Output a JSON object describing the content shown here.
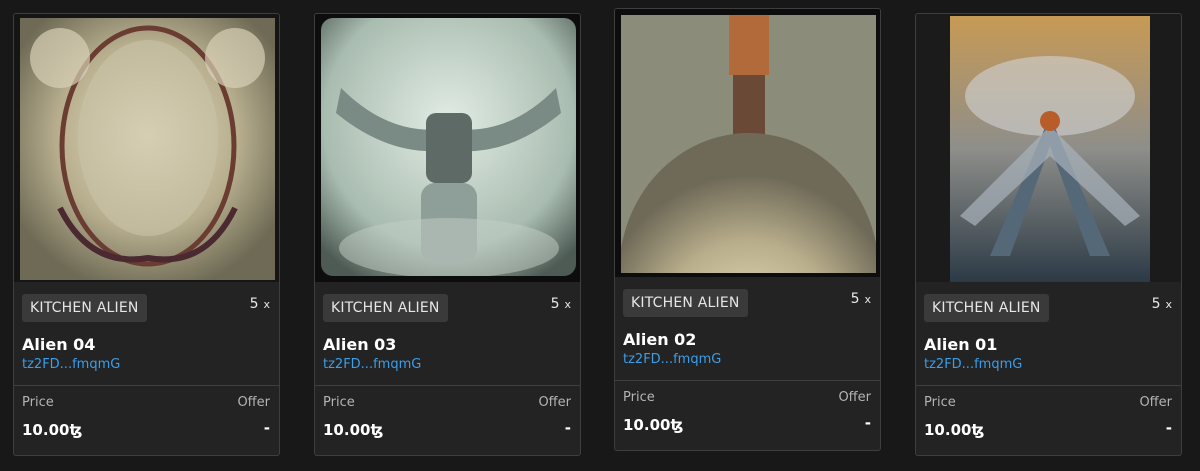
{
  "theme": {
    "background": "#181818",
    "card": "#232323",
    "link": "#3a9ee8"
  },
  "cards": [
    {
      "collection": "KITCHEN ALIEN",
      "editions": "5",
      "multiplier": "x",
      "title": "Alien 04",
      "creator": "tz2FD...fmqmG",
      "price_label": "Price",
      "offer_label": "Offer",
      "price": "10.00ꜩ",
      "offer": "-"
    },
    {
      "collection": "KITCHEN ALIEN",
      "editions": "5",
      "multiplier": "x",
      "title": "Alien 03",
      "creator": "tz2FD...fmqmG",
      "price_label": "Price",
      "offer_label": "Offer",
      "price": "10.00ꜩ",
      "offer": "-"
    },
    {
      "collection": "KITCHEN ALIEN",
      "editions": "5",
      "multiplier": "x",
      "title": "Alien 02",
      "creator": "tz2FD...fmqmG",
      "price_label": "Price",
      "offer_label": "Offer",
      "price": "10.00ꜩ",
      "offer": "-"
    },
    {
      "collection": "KITCHEN ALIEN",
      "editions": "5",
      "multiplier": "x",
      "title": "Alien 01",
      "creator": "tz2FD...fmqmG",
      "price_label": "Price",
      "offer_label": "Offer",
      "price": "10.00ꜩ",
      "offer": "-"
    }
  ]
}
